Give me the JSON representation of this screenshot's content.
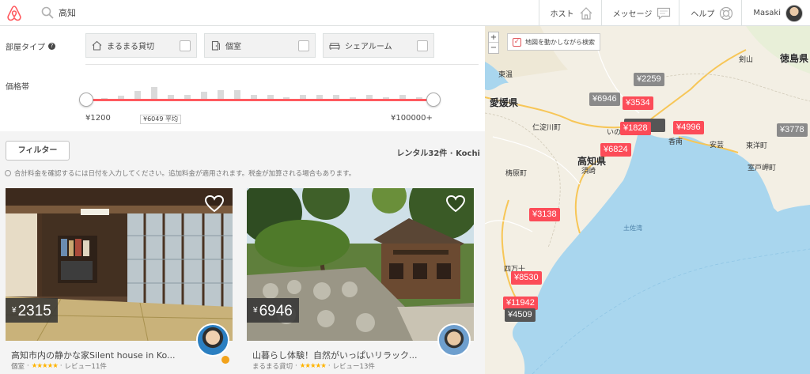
{
  "header": {
    "search_text": "高知",
    "nav": [
      {
        "label": "ホスト",
        "icon": "house-icon"
      },
      {
        "label": "メッセージ",
        "icon": "message-icon"
      },
      {
        "label": "ヘルプ",
        "icon": "lifebuoy-icon"
      },
      {
        "label": "Masaki",
        "icon": "avatar"
      }
    ]
  },
  "filters": {
    "room_type_label": "部屋タイプ",
    "room_types": [
      {
        "label": "まるまる貸切",
        "icon": "home-icon",
        "checked": false
      },
      {
        "label": "個室",
        "icon": "door-icon",
        "checked": false
      },
      {
        "label": "シェアルーム",
        "icon": "couch-icon",
        "checked": false
      }
    ],
    "price_label": "価格帯",
    "price_min": "¥1200",
    "price_avg": "¥6049 平均",
    "price_max": "¥100000+",
    "histogram": [
      0.15,
      0.25,
      0.55,
      0.75,
      0.3,
      0.3,
      0.5,
      0.6,
      0.6,
      0.3,
      0.3,
      0.2,
      0.3,
      0.3,
      0.3,
      0.2,
      0.3,
      0.2,
      0.3,
      0.2,
      0.3
    ]
  },
  "list": {
    "filter_button": "フィルター",
    "rental_count": "レンタル32件 · Kochi",
    "notice": "合計料金を確認するには日付を入力してください。追加料金が適用されます。税金が加算される場合もあります。",
    "cards": [
      {
        "price_symbol": "¥",
        "price": "2315",
        "title": "高知市内の静かな家Silent house in Ko...",
        "room_type": "個室",
        "stars": "★★★★★",
        "reviews": "レビュー11件"
      },
      {
        "price_symbol": "¥",
        "price": "6946",
        "title": "山暮らし体験！自然がいっぱいリラック...",
        "room_type": "まるまる貸切",
        "stars": "★★★★★",
        "reviews": "レビュー13件"
      }
    ]
  },
  "map": {
    "zoom_in": "+",
    "zoom_out": "−",
    "search_as_move": "地図を動かしながら検索",
    "pins": [
      {
        "label": "¥2259",
        "style": "grey"
      },
      {
        "label": "¥6946",
        "style": "grey"
      },
      {
        "label": "¥3534",
        "style": "red"
      },
      {
        "label": "¥1828",
        "style": "red"
      },
      {
        "label": "¥4996",
        "style": "red"
      },
      {
        "label": "¥3778",
        "style": "grey"
      },
      {
        "label": "¥6824",
        "style": "red"
      },
      {
        "label": "¥3138",
        "style": "red"
      },
      {
        "label": "¥8530",
        "style": "red"
      },
      {
        "label": "¥11942",
        "style": "red"
      },
      {
        "label": "¥4509",
        "style": "dark"
      }
    ],
    "places": [
      "愛媛県",
      "高知県",
      "徳島県",
      "香南",
      "安芸",
      "須崎",
      "東温",
      "仁淀川町",
      "梼原町",
      "四万十",
      "剣山",
      "土佐湾",
      "いの",
      "室戸岬町",
      "東洋町"
    ]
  },
  "colors": {
    "brand": "#ff5a5f",
    "pin_red": "#fc4c58",
    "sea": "#a9d6ee",
    "land": "#f5f1e8"
  }
}
